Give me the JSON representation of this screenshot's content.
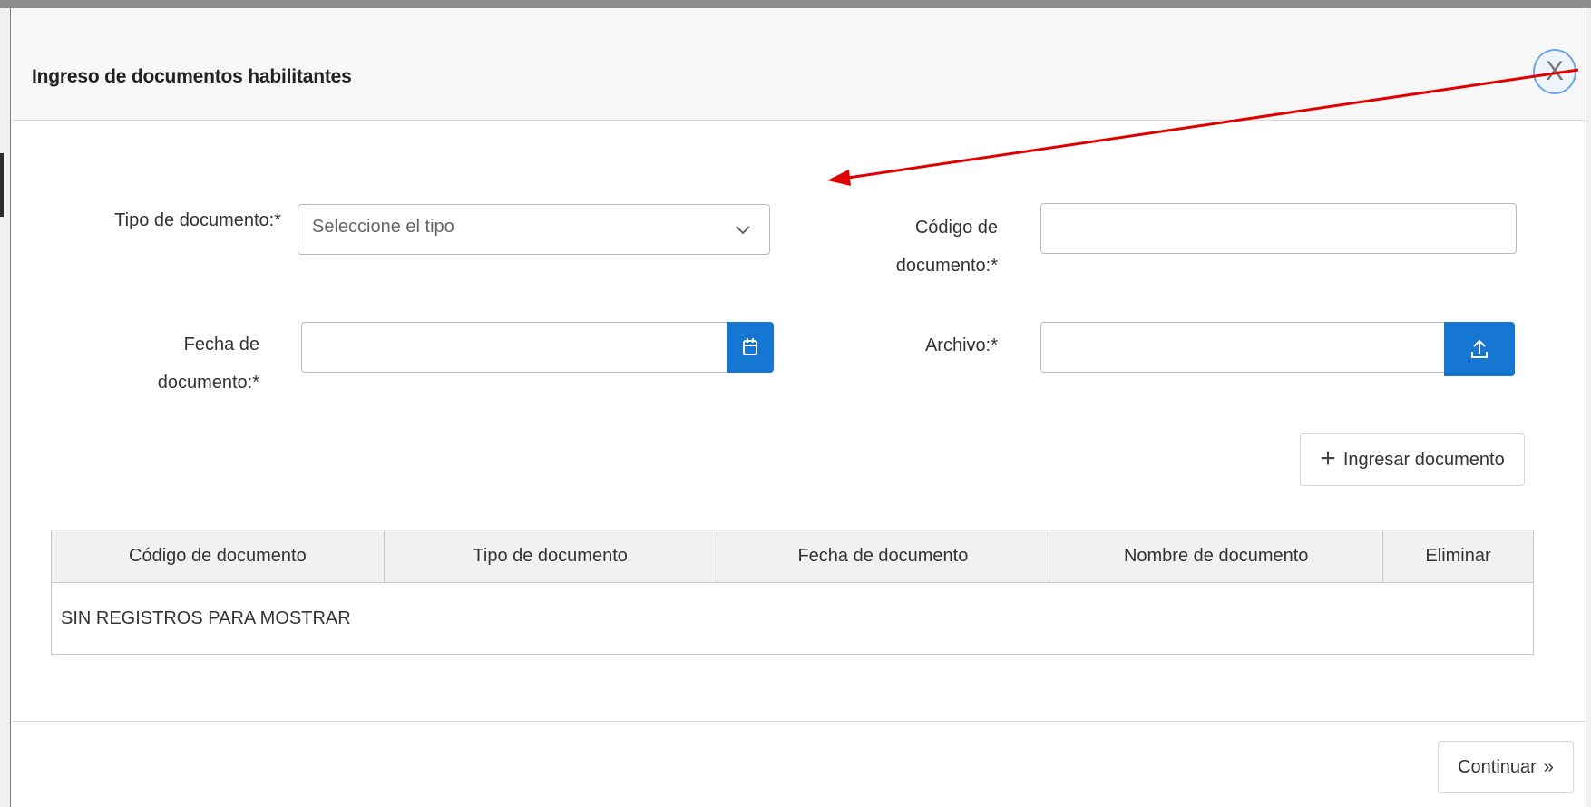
{
  "modal": {
    "title": "Ingreso de documentos habilitantes",
    "close_label": "X"
  },
  "form": {
    "tipo_label": "Tipo de documento:*",
    "tipo_placeholder": "Seleccione el tipo",
    "codigo_label_1": "Código de",
    "codigo_label_2": "documento:*",
    "codigo_value": "",
    "fecha_label_1": "Fecha de",
    "fecha_label_2": "documento:*",
    "fecha_value": "",
    "archivo_label": "Archivo:*",
    "archivo_value": "",
    "add_button_label": "Ingresar documento"
  },
  "table": {
    "columns": [
      "Código de documento",
      "Tipo de documento",
      "Fecha de documento",
      "Nombre de documento",
      "Eliminar"
    ],
    "empty_message": "SIN REGISTROS PARA MOSTRAR"
  },
  "footer": {
    "continue_label": "Continuar",
    "continue_icon": "»"
  },
  "colors": {
    "primary": "#1677d2",
    "annotation_arrow": "#e00000",
    "close_ring": "#6fa7e6"
  },
  "icons": {
    "select": "chevron-down-icon",
    "date": "calendar-icon",
    "file": "upload-icon",
    "add": "plus-icon",
    "continue": "double-chevron-right-icon"
  }
}
